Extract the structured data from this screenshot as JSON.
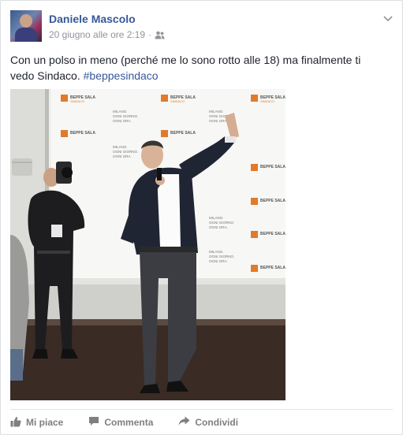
{
  "post": {
    "author": "Daniele Mascolo",
    "timestamp": "20 giugno alle ore 2:19",
    "separator": "·",
    "audience_icon": "friends-icon",
    "text_main": "Con un polso in meno (perché me lo sono rotto alle 18) ma finalmente ti vedo Sindaco.",
    "hashtag": "#beppesindaco",
    "photo": {
      "backdrop_brand": "BEPPE SALA",
      "backdrop_brand_sub": "SINDACO",
      "backdrop_slogan": [
        "MILANO.",
        "OGNI GIORNO.",
        "OGNI ORA."
      ]
    }
  },
  "actions": {
    "like": "Mi piace",
    "comment": "Commenta",
    "share": "Condividi"
  },
  "colors": {
    "link": "#365899",
    "text": "#1d2129",
    "meta": "#90949c",
    "action": "#7f7f7f",
    "brand_orange": "#e07b2b"
  }
}
